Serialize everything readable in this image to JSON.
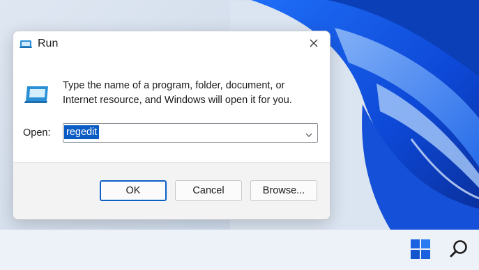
{
  "dialog": {
    "title": "Run",
    "description": "Type the name of a program, folder, document, or Internet resource, and Windows will open it for you.",
    "open_label": "Open:",
    "open_value": "regedit",
    "buttons": {
      "ok": "OK",
      "cancel": "Cancel",
      "browse": "Browse..."
    }
  },
  "icons": {
    "title": "run-icon",
    "large": "run-large-icon",
    "close": "close-icon",
    "dropdown": "chevron-down-icon",
    "start": "windows-start-icon",
    "search": "search-icon"
  },
  "colors": {
    "accent": "#0a5bc4",
    "dialog_bg": "#ffffff",
    "footer_bg": "#f3f3f3",
    "taskbar_bg": "#edf1f8",
    "windows_blue": "#1b62e0"
  }
}
